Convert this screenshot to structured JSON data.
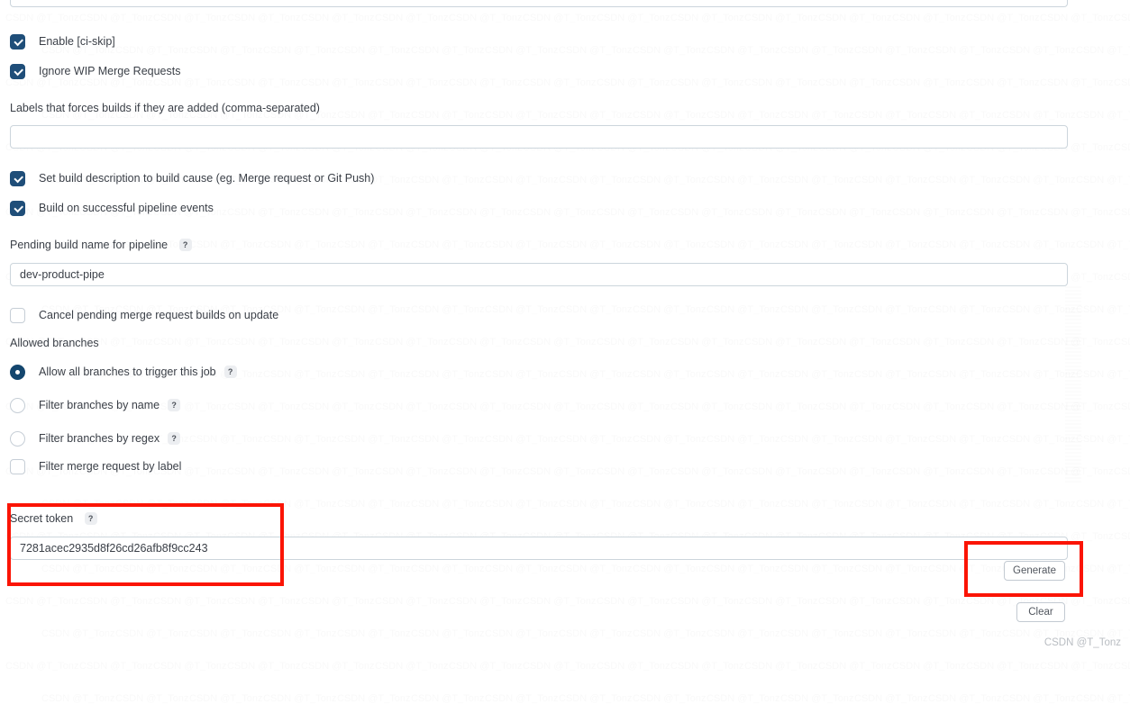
{
  "colors": {
    "accent_checkbox": "#1f4e79",
    "accent_radio": "#14466e",
    "annotation_red": "#fb1405",
    "input_border": "#ccd5dc",
    "text": "#3a3f47",
    "watermark_text": "#b9bdc2"
  },
  "help_glyph": "?",
  "checkboxes": [
    {
      "name": "enable-ci-skip",
      "label": "Enable [ci-skip]",
      "checked": true,
      "help": false
    },
    {
      "name": "ignore-wip-merge-requests",
      "label": "Ignore WIP Merge Requests",
      "checked": true,
      "help": false
    },
    {
      "name": "set-build-description",
      "label": "Set build description to build cause (eg. Merge request or Git Push)",
      "checked": true,
      "help": false
    },
    {
      "name": "build-on-successful-pipeline-events",
      "label": "Build on successful pipeline events",
      "checked": true,
      "help": false
    },
    {
      "name": "cancel-pending-merge-request-builds",
      "label": "Cancel pending merge request builds on update",
      "checked": false,
      "help": false
    },
    {
      "name": "filter-merge-request-by-label",
      "label": "Filter merge request by label",
      "checked": false,
      "help": false
    }
  ],
  "fields": {
    "labels_forcing_builds": {
      "label": "Labels that forces builds if they are added (comma-separated)",
      "value": "",
      "placeholder": ""
    },
    "pending_build_name": {
      "label": "Pending build name for pipeline",
      "help": "?",
      "value": "dev-product-pipe",
      "placeholder": ""
    },
    "secret_token": {
      "label": "Secret token",
      "help": "?",
      "value": "7281acec2935d8f26cd26afb8f9cc243",
      "placeholder": ""
    }
  },
  "allowed_branches": {
    "label": "Allowed branches",
    "options": [
      {
        "name": "allow-all-branches",
        "label": "Allow all branches to trigger this job",
        "selected": true,
        "help": "?"
      },
      {
        "name": "filter-branches-by-name",
        "label": "Filter branches by name",
        "selected": false,
        "help": "?"
      },
      {
        "name": "filter-branches-by-regex",
        "label": "Filter branches by regex",
        "selected": false,
        "help": "?"
      }
    ]
  },
  "buttons": {
    "generate": "Generate",
    "clear": "Clear"
  },
  "watermark": {
    "credit": "CSDN @T_Tonz",
    "tile_text": "CSDN @T_Tonz"
  }
}
